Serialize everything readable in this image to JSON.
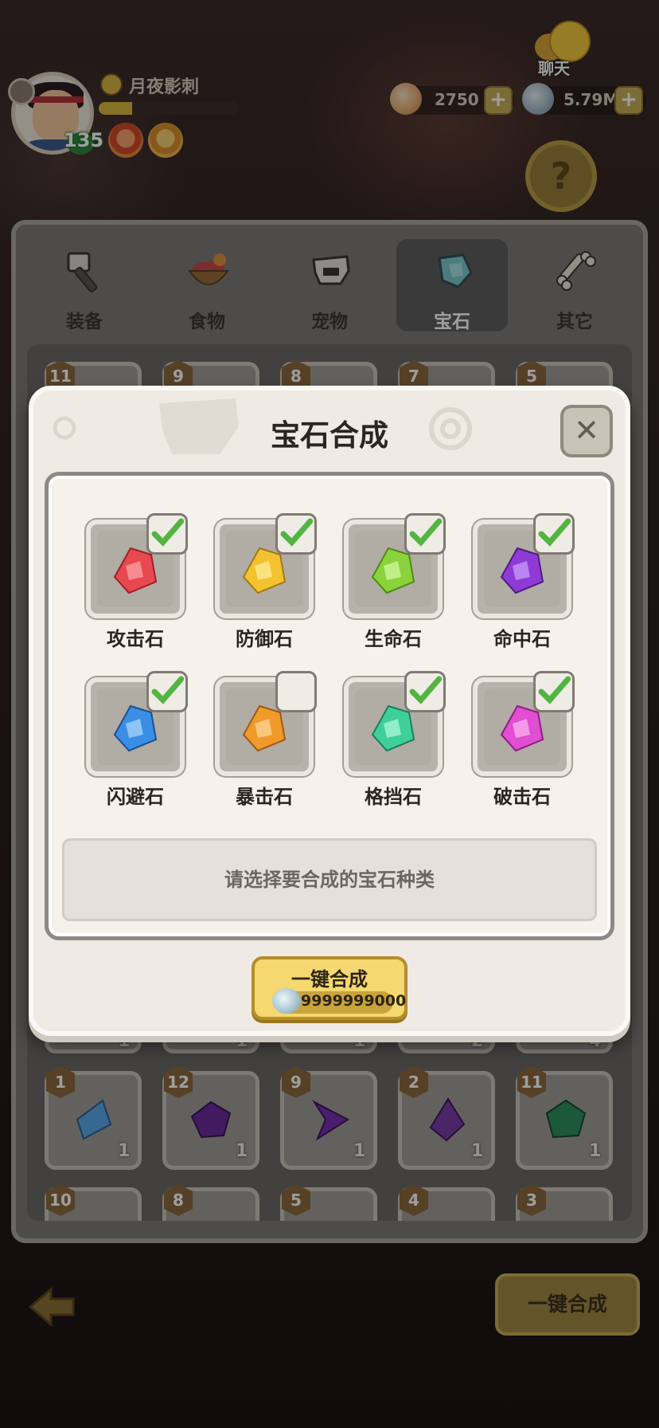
{
  "player": {
    "name": "月夜影刺",
    "level": "135",
    "exp_fraction": 0.24
  },
  "hud": {
    "chat_label": "聊天",
    "shells": "2750",
    "pearls": "5.79M",
    "help_icon": "question-badge-icon"
  },
  "tabs": [
    {
      "label": "装备",
      "icon": "hammer-icon",
      "active": false
    },
    {
      "label": "食物",
      "icon": "food-bowl-icon",
      "active": false
    },
    {
      "label": "宠物",
      "icon": "pet-skull-icon",
      "active": false
    },
    {
      "label": "宝石",
      "icon": "gem-icon",
      "active": true
    },
    {
      "label": "其它",
      "icon": "bone-icon",
      "active": false
    }
  ],
  "inventory": {
    "top_row_levels": [
      "11",
      "9",
      "8",
      "7",
      "5"
    ],
    "middle_row_counts": [
      "1",
      "1",
      "1",
      "2",
      "4"
    ],
    "gem_row": [
      {
        "level": "1",
        "count": "1",
        "color": "#5aa8e8"
      },
      {
        "level": "12",
        "count": "1",
        "color": "#6a2a9a"
      },
      {
        "level": "9",
        "count": "1",
        "color": "#7a2fb0"
      },
      {
        "level": "2",
        "count": "1",
        "color": "#7b3aa8"
      },
      {
        "level": "11",
        "count": "1",
        "color": "#2f8e5e"
      }
    ],
    "bottom_row_levels": [
      "10",
      "8",
      "5",
      "4",
      "3"
    ]
  },
  "bottom_button_label": "一键合成",
  "dialog": {
    "title": "宝石合成",
    "close_icon": "close-x-icon",
    "gems": [
      {
        "label": "攻击石",
        "color": "#e8484f",
        "checked": true
      },
      {
        "label": "防御石",
        "color": "#f3c22f",
        "checked": true
      },
      {
        "label": "生命石",
        "color": "#8bd33c",
        "checked": true
      },
      {
        "label": "命中石",
        "color": "#8e3bd6",
        "checked": true
      },
      {
        "label": "闪避石",
        "color": "#3a8ee6",
        "checked": true
      },
      {
        "label": "暴击石",
        "color": "#f09a2c",
        "checked": false
      },
      {
        "label": "格挡石",
        "color": "#3fcf9a",
        "checked": true
      },
      {
        "label": "破击石",
        "color": "#e04ed2",
        "checked": true
      }
    ],
    "hint": "请选择要合成的宝石种类",
    "synth_button": {
      "label": "一键合成",
      "cost": "9999999000"
    }
  },
  "colors": {
    "check_green": "#52b540",
    "button_gold": "#f5d86f",
    "panel_cream": "#efebe4"
  }
}
